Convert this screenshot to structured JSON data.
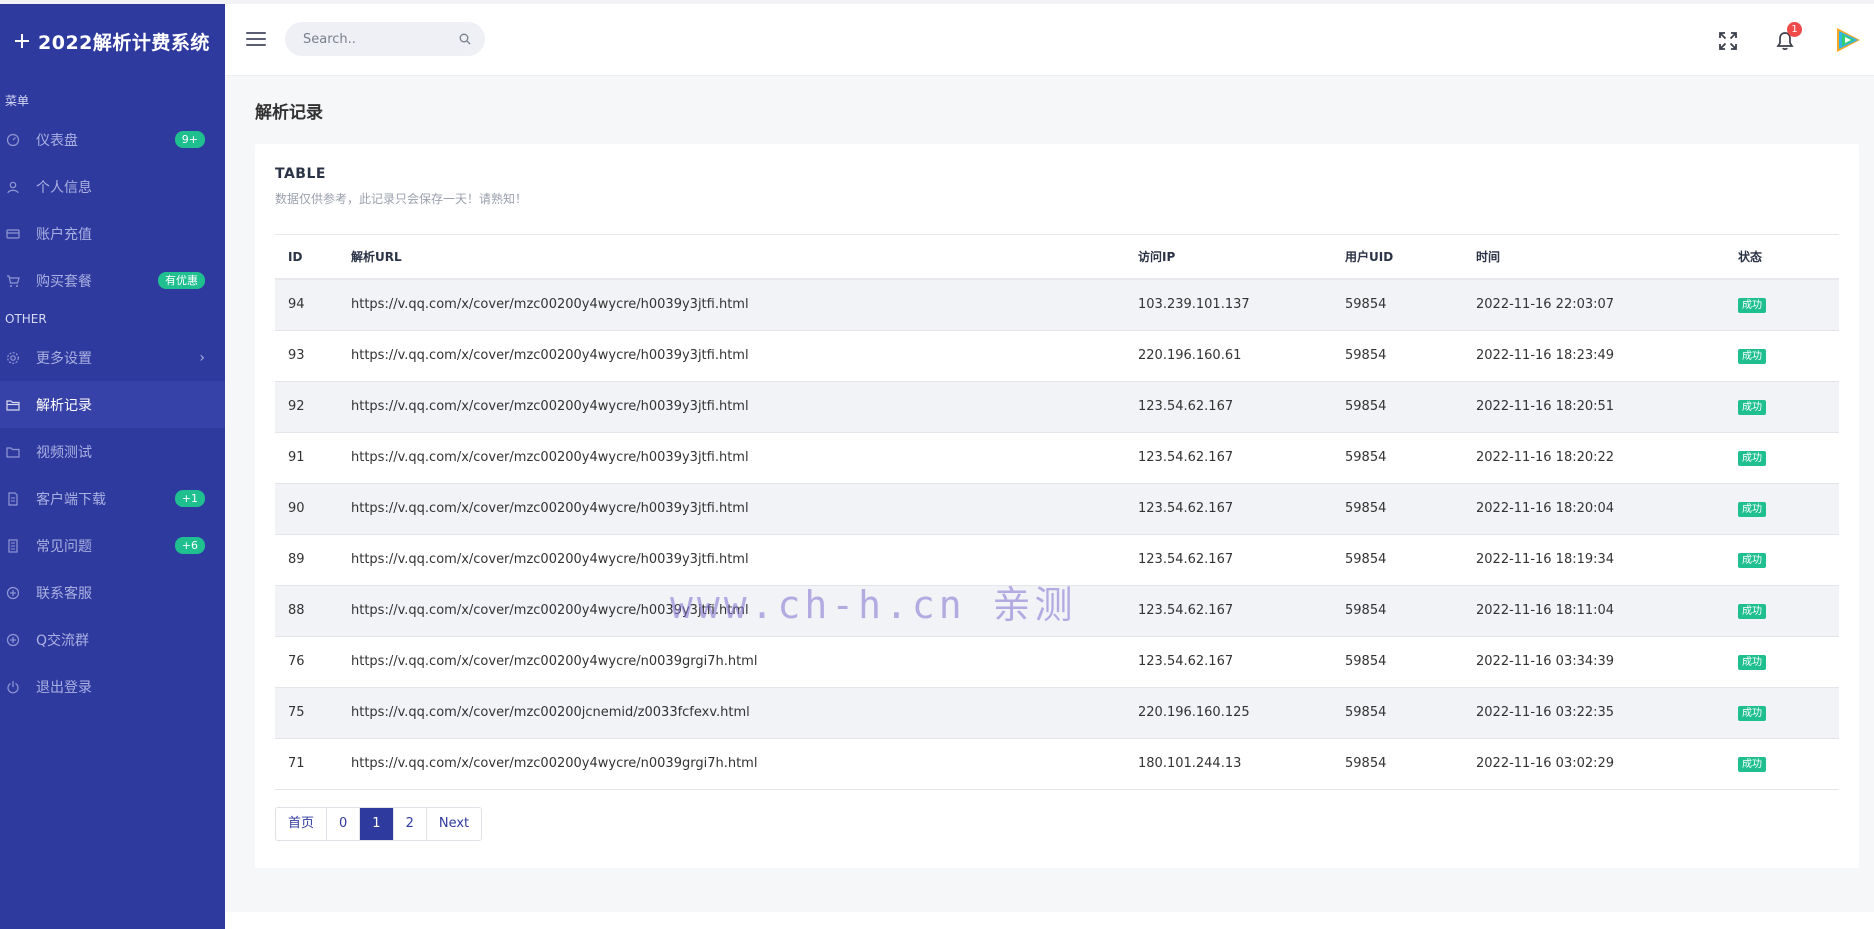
{
  "brand": {
    "title": "2022解析计费系统"
  },
  "sidebar": {
    "section_menu": "菜单",
    "section_other": "OTHER",
    "items": [
      {
        "label": "仪表盘",
        "icon": "dashboard-icon",
        "badge": "9+"
      },
      {
        "label": "个人信息",
        "icon": "user-icon",
        "badge": ""
      },
      {
        "label": "账户充值",
        "icon": "credit-card-icon",
        "badge": ""
      },
      {
        "label": "购买套餐",
        "icon": "cart-icon",
        "badge": "有优惠"
      }
    ],
    "other_items": [
      {
        "label": "更多设置",
        "icon": "gear-icon",
        "badge": "",
        "chevron": "›"
      },
      {
        "label": "解析记录",
        "icon": "folder-icon",
        "badge": "",
        "active": true
      },
      {
        "label": "视频测试",
        "icon": "video-icon",
        "badge": ""
      },
      {
        "label": "客户端下载",
        "icon": "file-icon",
        "badge": "+1"
      },
      {
        "label": "常见问题",
        "icon": "document-icon",
        "badge": "+6"
      },
      {
        "label": "联系客服",
        "icon": "plus-circle-icon",
        "badge": ""
      },
      {
        "label": "Q交流群",
        "icon": "plus-circle-icon",
        "badge": ""
      },
      {
        "label": "退出登录",
        "icon": "power-icon",
        "badge": ""
      }
    ]
  },
  "header": {
    "search_placeholder": "Search..",
    "notification_count": "1"
  },
  "main": {
    "page_title": "解析记录",
    "card_title": "TABLE",
    "card_subtitle": "数据仅供参考，此记录只会保存一天！请熟知！",
    "columns": [
      "ID",
      "解析URL",
      "访问IP",
      "用户UID",
      "时间",
      "状态"
    ],
    "rows": [
      {
        "id": "94",
        "url": "https://v.qq.com/x/cover/mzc00200y4wycre/h0039y3jtfi.html",
        "ip": "103.239.101.137",
        "uid": "59854",
        "time": "2022-11-16 22:03:07",
        "status": "成功"
      },
      {
        "id": "93",
        "url": "https://v.qq.com/x/cover/mzc00200y4wycre/h0039y3jtfi.html",
        "ip": "220.196.160.61",
        "uid": "59854",
        "time": "2022-11-16 18:23:49",
        "status": "成功"
      },
      {
        "id": "92",
        "url": "https://v.qq.com/x/cover/mzc00200y4wycre/h0039y3jtfi.html",
        "ip": "123.54.62.167",
        "uid": "59854",
        "time": "2022-11-16 18:20:51",
        "status": "成功"
      },
      {
        "id": "91",
        "url": "https://v.qq.com/x/cover/mzc00200y4wycre/h0039y3jtfi.html",
        "ip": "123.54.62.167",
        "uid": "59854",
        "time": "2022-11-16 18:20:22",
        "status": "成功"
      },
      {
        "id": "90",
        "url": "https://v.qq.com/x/cover/mzc00200y4wycre/h0039y3jtfi.html",
        "ip": "123.54.62.167",
        "uid": "59854",
        "time": "2022-11-16 18:20:04",
        "status": "成功"
      },
      {
        "id": "89",
        "url": "https://v.qq.com/x/cover/mzc00200y4wycre/h0039y3jtfi.html",
        "ip": "123.54.62.167",
        "uid": "59854",
        "time": "2022-11-16 18:19:34",
        "status": "成功"
      },
      {
        "id": "88",
        "url": "https://v.qq.com/x/cover/mzc00200y4wycre/h0039y3jtfi.html",
        "ip": "123.54.62.167",
        "uid": "59854",
        "time": "2022-11-16 18:11:04",
        "status": "成功"
      },
      {
        "id": "76",
        "url": "https://v.qq.com/x/cover/mzc00200y4wycre/n0039grgi7h.html",
        "ip": "123.54.62.167",
        "uid": "59854",
        "time": "2022-11-16 03:34:39",
        "status": "成功"
      },
      {
        "id": "75",
        "url": "https://v.qq.com/x/cover/mzc00200jcnemid/z0033fcfexv.html",
        "ip": "220.196.160.125",
        "uid": "59854",
        "time": "2022-11-16 03:22:35",
        "status": "成功"
      },
      {
        "id": "71",
        "url": "https://v.qq.com/x/cover/mzc00200y4wycre/n0039grgi7h.html",
        "ip": "180.101.244.13",
        "uid": "59854",
        "time": "2022-11-16 03:02:29",
        "status": "成功"
      }
    ],
    "pagination": [
      "首页",
      "0",
      "1",
      "2",
      "Next"
    ],
    "pagination_active": "1"
  },
  "watermark": "www.ch-h.cn  亲测",
  "colors": {
    "sidebar_bg": "#2f3a9f",
    "accent_green": "#1fbf8f",
    "notification_red": "#ef4b4b"
  }
}
